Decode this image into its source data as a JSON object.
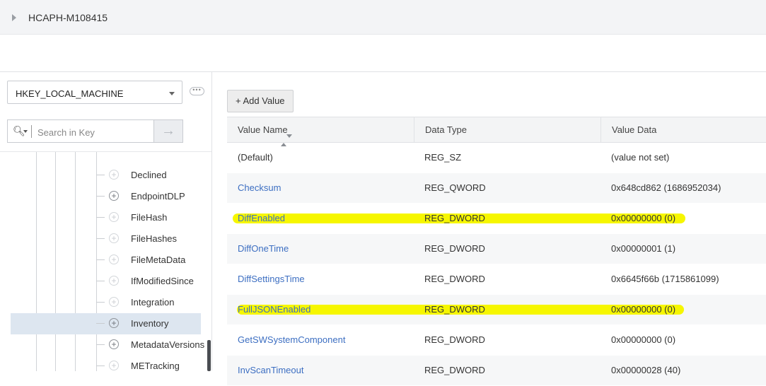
{
  "header": {
    "machine_name": "HCAPH-M108415"
  },
  "left_panel": {
    "hive_select": {
      "value": "HKEY_LOCAL_MACHINE"
    },
    "search": {
      "placeholder": "Search in Key",
      "value": ""
    },
    "tree_items": [
      {
        "label": "Declined",
        "selected": false
      },
      {
        "label": "EndpointDLP",
        "selected": false
      },
      {
        "label": "FileHash",
        "selected": false
      },
      {
        "label": "FileHashes",
        "selected": false
      },
      {
        "label": "FileMetaData",
        "selected": false
      },
      {
        "label": "IfModifiedSince",
        "selected": false
      },
      {
        "label": "Integration",
        "selected": false
      },
      {
        "label": "Inventory",
        "selected": true
      },
      {
        "label": "MetadataVersions",
        "selected": false
      },
      {
        "label": "METracking",
        "selected": false
      }
    ]
  },
  "right_panel": {
    "add_value_label": "Add Value",
    "columns": {
      "name": "Value Name",
      "type": "Data Type",
      "data": "Value Data"
    },
    "rows": [
      {
        "name": "(Default)",
        "type": "REG_SZ",
        "data": "(value not set)",
        "link": false,
        "highlighted": false
      },
      {
        "name": "Checksum",
        "type": "REG_QWORD",
        "data": "0x648cd862 (1686952034)",
        "link": true,
        "highlighted": false
      },
      {
        "name": "DiffEnabled",
        "type": "REG_DWORD",
        "data": "0x00000000 (0)",
        "link": true,
        "highlighted": true
      },
      {
        "name": "DiffOneTime",
        "type": "REG_DWORD",
        "data": "0x00000001 (1)",
        "link": true,
        "highlighted": false
      },
      {
        "name": "DiffSettingsTime",
        "type": "REG_DWORD",
        "data": "0x6645f66b (1715861099)",
        "link": true,
        "highlighted": false
      },
      {
        "name": "FullJSONEnabled",
        "type": "REG_DWORD",
        "data": "0x00000000 (0)",
        "link": true,
        "highlighted": true
      },
      {
        "name": "GetSWSystemComponent",
        "type": "REG_DWORD",
        "data": "0x00000000 (0)",
        "link": true,
        "highlighted": false
      },
      {
        "name": "InvScanTimeout",
        "type": "REG_DWORD",
        "data": "0x00000028 (40)",
        "link": true,
        "highlighted": false
      }
    ]
  },
  "colors": {
    "link": "#3d6fc2",
    "highlight": "#f6f600",
    "selected_row": "#dde6f0"
  },
  "icons": [
    "expand-arrow-icon",
    "dropdown-arrow-icon",
    "more-options-icon",
    "search-icon",
    "go-arrow-icon",
    "expand-plus-icon",
    "sort-icon",
    "plus-icon"
  ]
}
